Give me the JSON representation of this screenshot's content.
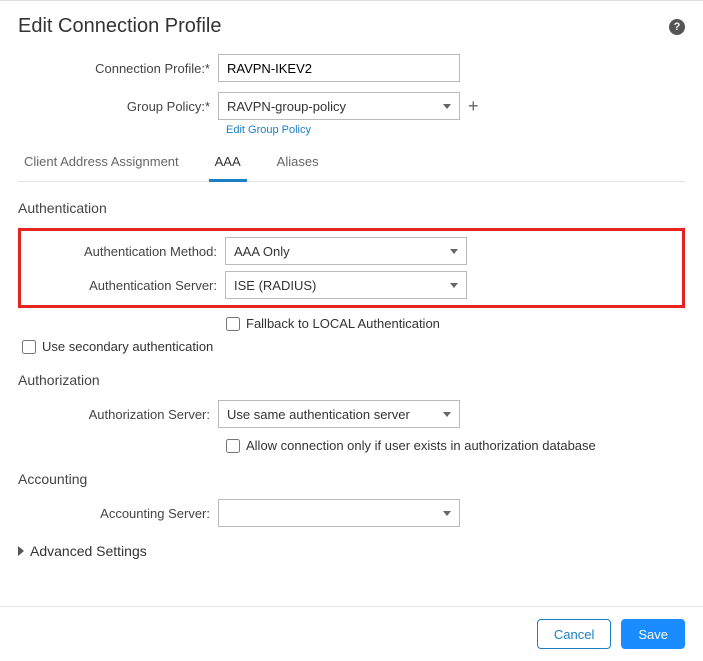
{
  "dialog": {
    "title": "Edit Connection Profile"
  },
  "fields": {
    "connection_profile_label": "Connection Profile:*",
    "connection_profile_value": "RAVPN-IKEV2",
    "group_policy_label": "Group Policy:*",
    "group_policy_value": "RAVPN-group-policy",
    "edit_group_policy_link": "Edit Group Policy"
  },
  "tabs": {
    "t0": "Client Address Assignment",
    "t1": "AAA",
    "t2": "Aliases"
  },
  "authentication": {
    "section_title": "Authentication",
    "method_label": "Authentication Method:",
    "method_value": "AAA Only",
    "server_label": "Authentication Server:",
    "server_value": "ISE (RADIUS)",
    "fallback_label": "Fallback to LOCAL Authentication",
    "secondary_label": "Use secondary authentication"
  },
  "authorization": {
    "section_title": "Authorization",
    "server_label": "Authorization Server:",
    "server_value": "Use same authentication server",
    "allow_conn_label": "Allow connection only if user exists in authorization database"
  },
  "accounting": {
    "section_title": "Accounting",
    "server_label": "Accounting Server:",
    "server_value": ""
  },
  "advanced": {
    "label": "Advanced Settings"
  },
  "footer": {
    "cancel": "Cancel",
    "save": "Save"
  }
}
